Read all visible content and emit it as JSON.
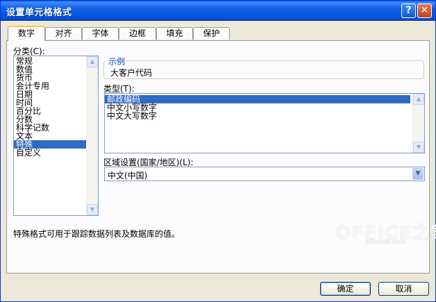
{
  "window": {
    "title": "设置单元格格式",
    "help_glyph": "?",
    "close_glyph": "✕"
  },
  "tabs": [
    {
      "label": "数字",
      "active": true
    },
    {
      "label": "对齐",
      "active": false
    },
    {
      "label": "字体",
      "active": false
    },
    {
      "label": "边框",
      "active": false
    },
    {
      "label": "填充",
      "active": false
    },
    {
      "label": "保护",
      "active": false
    }
  ],
  "category": {
    "label": "分类(C):",
    "items": [
      "常规",
      "数值",
      "货币",
      "会计专用",
      "日期",
      "时间",
      "百分比",
      "分数",
      "科学记数",
      "文本",
      "特殊",
      "自定义"
    ],
    "selected": "特殊"
  },
  "sample": {
    "legend": "示例",
    "value": "大客户代码"
  },
  "type": {
    "label": "类型(T):",
    "items": [
      "邮政编码",
      "中文小写数字",
      "中文大写数字"
    ],
    "selected": "邮政编码"
  },
  "locale": {
    "label": "区域设置(国家/地区)(L):",
    "value": "中文(中国)"
  },
  "description": "特殊格式可用于跟踪数据列表及数据库的值。",
  "buttons": {
    "ok": "确定",
    "cancel": "取消"
  },
  "watermark": {
    "main": "OFFICE之家",
    "sub": "office68.com"
  },
  "colors": {
    "titlebar": "#0a5ee8",
    "selection": "#316ac5",
    "active_tab_accent": "#ffc83c"
  }
}
